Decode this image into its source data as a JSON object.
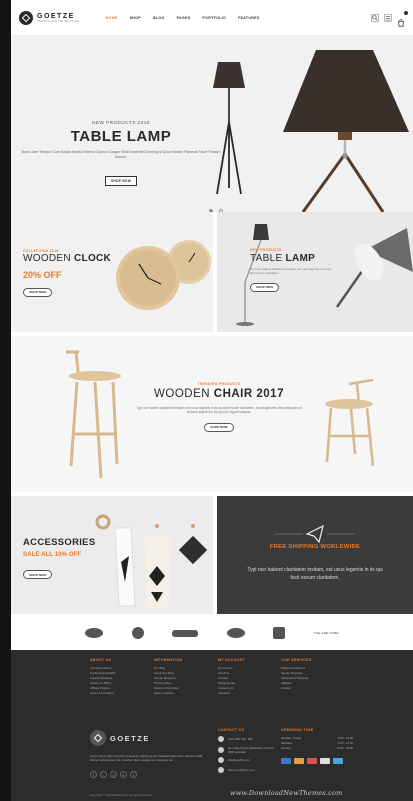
{
  "header": {
    "brand": "GOETZE",
    "brand_sub": "FASHION GOETZE DESIGNER",
    "nav": [
      "HOME",
      "SHOP",
      "BLOG",
      "PAGES",
      "PORTFOLIO",
      "FEATURES"
    ]
  },
  "hero": {
    "eyebrow": "NEW PRODUCTS 2016",
    "title": "TABLE LAMP",
    "description": "Ikam Liber Tempor Cum Soluta Nobis Eleifend Option Congue Nihil Imperdiet Doming Id Quod Mazim Placerat Facer Possim Assum.",
    "button": "SHOP NOW"
  },
  "banner_clock": {
    "eyebrow": "COLLECTION 2016",
    "title_light": "WOODEN",
    "title_bold": "CLOCK",
    "promo": "20% OFF",
    "button": "SHOP NOW"
  },
  "banner_lamp": {
    "eyebrow": "NEW PRODUCTS",
    "title_light": "TABLE",
    "title_bold": "LAMP",
    "description": "Typi non habent claritatem insitam; est usus legentis in iis qui facit eorum claritatem.",
    "button": "SHOP NOW"
  },
  "chair": {
    "eyebrow": "TRENDING PRODUCTS",
    "title_light": "WOODEN",
    "title_bold": "CHAIR 2017",
    "description": "Typi non habent claritatem insitam; est usus legentis in iis qui facit eorum claritatem. Investigationes demonstraverunt lectores legere me lius quod ii legunt saepius.",
    "button": "SHOP NOW"
  },
  "banner_accessories": {
    "title": "ACCESSORIES",
    "sale": "SALE ALL 10% OFF",
    "button": "SHOP NOW"
  },
  "banner_shipping": {
    "title": "FREE SHIPPING WORLDWIDE",
    "description": "Typi non habent claritatem insitam, est usus legentis in iis qui facit eorum claritatem."
  },
  "brands": [
    "THE ARE CORE"
  ],
  "footer": {
    "about_us": {
      "title": "ABOUT US",
      "items": [
        "Company History",
        "Socila Responsibility",
        "Creative Retailers",
        "Jewelry at Tiffany",
        "Affiliate Program",
        "Terms & Conditions"
      ]
    },
    "information": {
      "title": "INFORMATION",
      "items": [
        "Our Blog",
        "About Our Shop",
        "Secure Shopping",
        "Privacy Policy",
        "Delivery Information",
        "Store Locations"
      ]
    },
    "my_account": {
      "title": "MY ACCOUNT",
      "items": [
        "My Account",
        "About Us",
        "Contact",
        "Shopping cart",
        "Custom Link",
        "Checkout"
      ]
    },
    "our_services": {
      "title": "OUR SERVICES",
      "items": [
        "Shipping & Returns",
        "Secure Shopping",
        "International Shipping",
        "Affiliates",
        "Contact"
      ]
    },
    "brand": "GOETZE",
    "description": "Lorem ipsum dolor sit amet consectetur adipiscing elit. Phasellus diam arcu, placerat vitalis ultrices vehicula sed nisl. Curabitur diam egestas nec massa ut dui.",
    "socials": [
      "f",
      "t",
      "g",
      "in",
      "p"
    ],
    "contact": {
      "title": "CONTACT US",
      "phone": "(123) 456 789 - 999",
      "address": "No Cable Street, Melbourne, Victoria 3000 Australia",
      "email": "info@goetze.com",
      "web": "Shop.yourtheme.com"
    },
    "hours": {
      "title": "UPENNING TIME",
      "rows": [
        [
          "Monday - Friday",
          "8.00 - 20.00"
        ],
        [
          "Saturday",
          "8.00 - 21.00"
        ],
        [
          "Sunday",
          "10.00 - 20.00"
        ]
      ]
    },
    "copyright": "Copyright © 2016 BootExperts. All rights reserved"
  },
  "watermark": "www.DownloadNewThemes.com",
  "colors": {
    "accent": "#e8792b",
    "dark": "#2c2c2c"
  }
}
